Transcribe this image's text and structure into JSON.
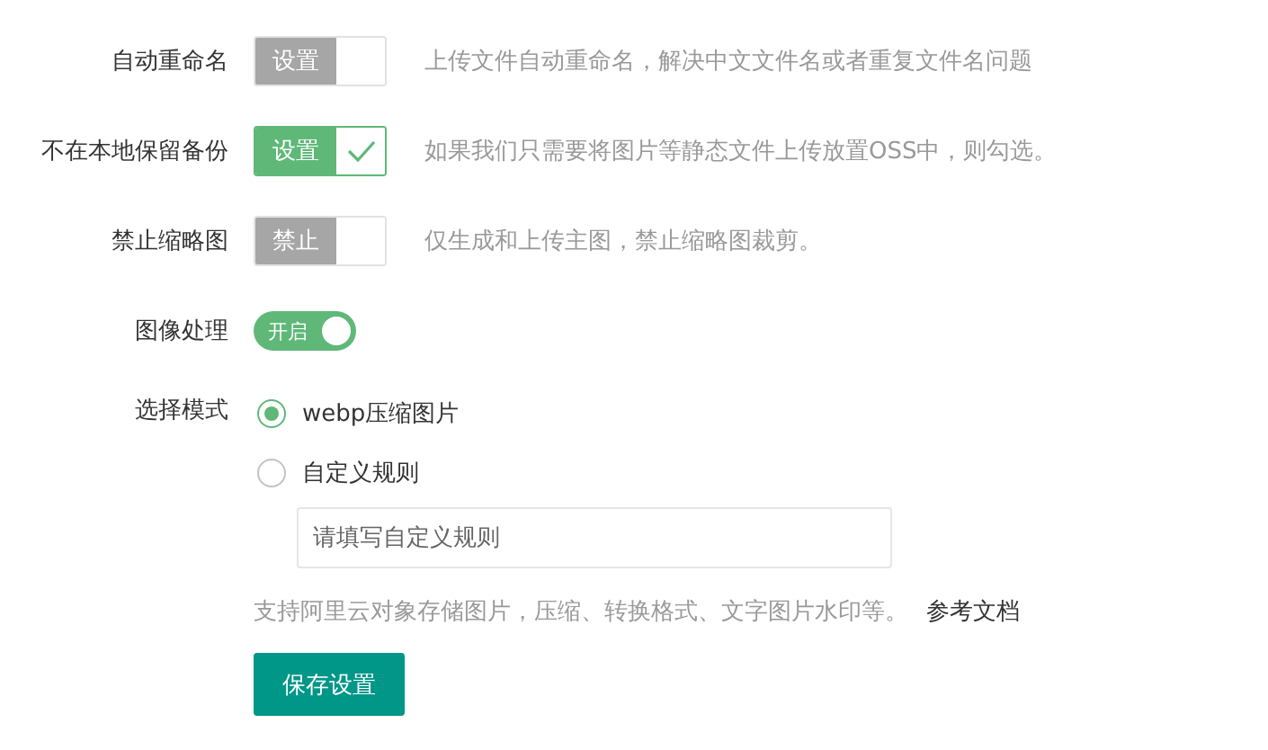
{
  "settings": [
    {
      "kind": "checkbox",
      "label": "自动重命名",
      "box_text": "设置",
      "checked": false,
      "description": "上传文件自动重命名，解决中文文件名或者重复文件名问题"
    },
    {
      "kind": "checkbox",
      "label": "不在本地保留备份",
      "box_text": "设置",
      "checked": true,
      "description": "如果我们只需要将图片等静态文件上传放置OSS中，则勾选。"
    },
    {
      "kind": "checkbox",
      "label": "禁止缩略图",
      "box_text": "禁止",
      "checked": false,
      "description": "仅生成和上传主图，禁止缩略图裁剪。"
    },
    {
      "kind": "switch",
      "label": "图像处理",
      "switch_text": "开启",
      "on": true
    }
  ],
  "mode": {
    "label": "选择模式",
    "options": [
      {
        "label": "webp压缩图片",
        "selected": true
      },
      {
        "label": "自定义规则",
        "selected": false
      }
    ],
    "rule_input": {
      "placeholder": "请填写自定义规则"
    }
  },
  "help": {
    "text": "支持阿里云对象存储图片，压缩、转换格式、文字图片水印等。",
    "link": "参考文档"
  },
  "save_button": "保存设置"
}
